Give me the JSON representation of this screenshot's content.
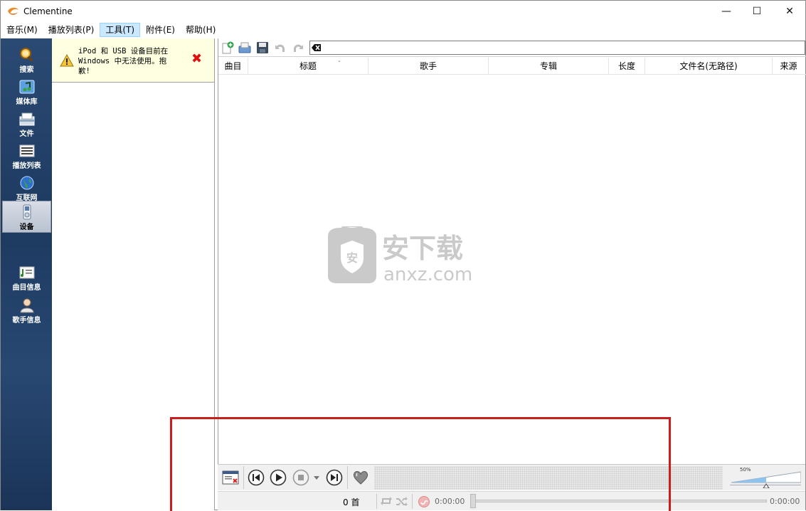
{
  "window": {
    "title": "Clementine",
    "min_glyph": "—",
    "max_glyph": "☐",
    "close_glyph": "✕"
  },
  "menu": [
    {
      "label": "音乐(M)"
    },
    {
      "label": "播放列表(P)"
    },
    {
      "label": "工具(T)",
      "active": true
    },
    {
      "label": "附件(E)"
    },
    {
      "label": "帮助(H)"
    }
  ],
  "sidebar": {
    "items": [
      {
        "label": "搜索",
        "icon": "search-icon"
      },
      {
        "label": "媒体库",
        "icon": "library-icon"
      },
      {
        "label": "文件",
        "icon": "files-icon"
      },
      {
        "label": "播放列表",
        "icon": "playlists-icon"
      },
      {
        "label": "互联网",
        "icon": "internet-icon"
      },
      {
        "label": "设备",
        "icon": "device-icon",
        "active": true
      },
      {
        "label": "曲目信息",
        "icon": "song-info-icon"
      },
      {
        "label": "歌手信息",
        "icon": "artist-info-icon"
      }
    ]
  },
  "devices": {
    "notice_line1": "iPod 和 USB 设备目前在",
    "notice_line2": "Windows 中无法使用。抱",
    "notice_line3": "歉!"
  },
  "playlist": {
    "columns": [
      "曲目",
      "标题",
      "歌手",
      "专辑",
      "长度",
      "文件名(无路径)",
      "来源"
    ],
    "filter_value": ""
  },
  "watermark": {
    "cn": "安下载",
    "domain": "anxz.com",
    "badge": "安"
  },
  "volume": {
    "label": "50%",
    "level": 0.5
  },
  "status": {
    "track_count": "0 首",
    "time_elapsed": "0:00:00",
    "time_total": "0:00:00"
  },
  "colors": {
    "sidebar": "#284872",
    "accent": "#cce8ff",
    "highlight": "#c81e1e",
    "notice_bg": "#ffffe1"
  }
}
